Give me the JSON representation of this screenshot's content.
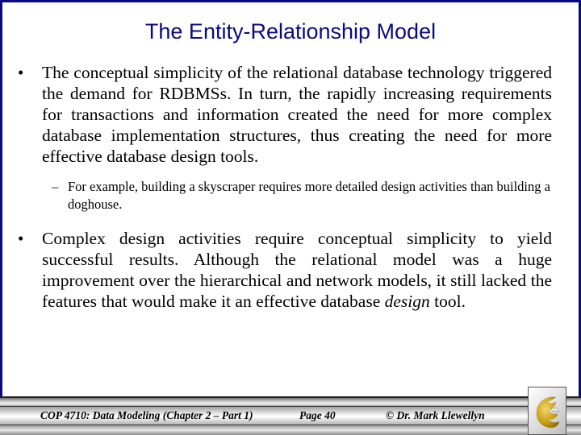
{
  "slide": {
    "title": "The Entity-Relationship Model",
    "bullets": [
      {
        "marker": "•",
        "text": "The conceptual simplicity of the relational database technology triggered the demand for RDBMSs.  In turn, the rapidly increasing requirements for transactions and information created the need for more complex database implementation structures, thus creating the need for more effective database design tools."
      },
      {
        "marker": "•",
        "text_before_italic": "Complex design activities require conceptual simplicity to yield successful results.  Although the relational model was a huge improvement over the hierarchical and network models, it still lacked the features that would make it an effective database ",
        "italic": "design",
        "text_after_italic": " tool."
      }
    ],
    "sub_bullets": [
      {
        "marker": "–",
        "text": "For example, building a skyscraper requires more detailed design activities than building a doghouse."
      }
    ]
  },
  "footer": {
    "course": "COP 4710: Data Modeling (Chapter 2 – Part 1)",
    "page": "Page 40",
    "copyright": "© Dr. Mark Llewellyn",
    "logo": "ucf-pegasus-logo-icon"
  },
  "colors": {
    "title": "#0a0a80",
    "frame": "#0a0a80",
    "logo_gold": "#c9a21a"
  }
}
